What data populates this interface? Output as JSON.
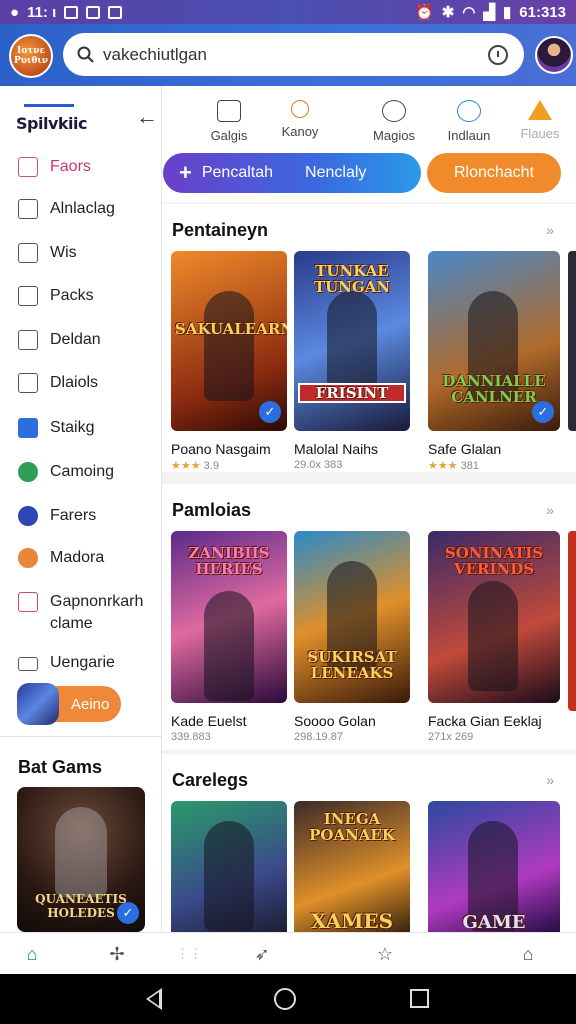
{
  "status_bar": {
    "time": "11: ι",
    "right_text": "61:313"
  },
  "app_bar": {
    "logo_text": "Ιοτνε Ρυιθιν",
    "search_value": "vakechiutlgan"
  },
  "sidebar": {
    "brand": "Spilvkiic",
    "items": [
      {
        "label": "Faors",
        "icon": "heart-icon",
        "active": true
      },
      {
        "label": "Alnlaclag",
        "icon": "document-icon",
        "active": false
      },
      {
        "label": "Wis",
        "icon": "copy-icon",
        "active": false
      },
      {
        "label": "Packs",
        "icon": "package-icon",
        "active": false
      },
      {
        "label": "Deldan",
        "icon": "edit-icon",
        "active": false
      },
      {
        "label": "Dlaiols",
        "icon": "list-icon",
        "active": false
      },
      {
        "label": "Staikg",
        "icon": "checkbox-icon",
        "active": false
      },
      {
        "label": "Camoing",
        "icon": "leaf-icon",
        "active": false
      },
      {
        "label": "Farers",
        "icon": "globe-icon",
        "active": false
      },
      {
        "label": "Madora",
        "icon": "badge-icon",
        "active": false
      },
      {
        "label": "Gapnonrkarh",
        "label2": "clame",
        "icon": "gamepad-icon",
        "active": false
      },
      {
        "label": "Uengarie",
        "icon": "controller-icon",
        "active": false
      }
    ],
    "pill_label": "Aeino",
    "section_title": "Bat Gams",
    "card_title": "QUANEAETIS HOLEDES"
  },
  "categories": [
    {
      "label": "Galgis",
      "icon": "newspaper-icon"
    },
    {
      "label": "Kanoy",
      "icon": "search-icon"
    },
    {
      "label": "Magios",
      "icon": "ring-icon"
    },
    {
      "label": "Indlaun",
      "icon": "refresh-icon"
    },
    {
      "label": "Flaues",
      "icon": "home-icon"
    }
  ],
  "actions": {
    "primary_label": "Pencaltah",
    "primary_label2": "Nenclaly",
    "secondary_label": "Rlonchacht"
  },
  "sections": [
    {
      "title": "Pentaineyn",
      "games": [
        {
          "art_text": "SAKUALEARNI",
          "name": "Poano Nasgaim",
          "meta": "3.9",
          "stars": "★★★",
          "colors": [
            "#f08a2a",
            "#8a2a10"
          ]
        },
        {
          "art_text": "TUNKAE TUNGAN",
          "art_text2": "FRISINT",
          "name": "Malolal Naihs",
          "meta": "29.0x 383",
          "stars": "",
          "colors": [
            "#2a3a8a",
            "#5a8ae0"
          ]
        },
        {
          "art_text": "DANNIALLE CANLNER",
          "name": "Safe Glalan",
          "meta": "381",
          "stars": "★★★",
          "colors": [
            "#4a88c8",
            "#b06a2a"
          ]
        }
      ]
    },
    {
      "title": "Pamloias",
      "games": [
        {
          "art_text": "ZANIBIIS HERIES",
          "name": "Kade Euelst",
          "meta": "339.883",
          "stars": "",
          "colors": [
            "#5a2a8a",
            "#e06aa0"
          ]
        },
        {
          "art_text": "SUKIRSAT LENEAKS",
          "name": "Soooo Golan",
          "meta": "298.19.87",
          "stars": "",
          "colors": [
            "#2a8ac8",
            "#e0902a"
          ]
        },
        {
          "art_text": "SONINATIS VERINDS",
          "name": "Facka Gian Eeklaj",
          "meta": "271x 269",
          "stars": "",
          "colors": [
            "#3a2a6a",
            "#c04a3a"
          ]
        }
      ]
    },
    {
      "title": "Carelegs",
      "games": [
        {
          "art_text": "",
          "name": "",
          "meta": "",
          "stars": "",
          "colors": [
            "#2a9a6a",
            "#3a4a8a"
          ]
        },
        {
          "art_text": "INEGA POANAEK",
          "art_text2": "XAMES",
          "name": "",
          "meta": "",
          "stars": "",
          "colors": [
            "#3a2a2a",
            "#e0902a"
          ]
        },
        {
          "art_text": "GAME",
          "name": "",
          "meta": "",
          "stars": "",
          "colors": [
            "#2a4aa0",
            "#b03ac0"
          ]
        }
      ]
    }
  ],
  "tabbar": [
    {
      "icon": "home-icon",
      "glyph": "⌂",
      "active": true
    },
    {
      "icon": "puzzle-icon",
      "glyph": "✢",
      "active": false
    },
    {
      "icon": "grid-icon",
      "glyph": "⋮⋮",
      "active": false
    },
    {
      "icon": "send-icon",
      "glyph": "➶",
      "active": false
    },
    {
      "icon": "star-icon",
      "glyph": "☆",
      "active": false
    },
    {
      "icon": "store-icon",
      "glyph": "⌂",
      "active": false
    }
  ]
}
